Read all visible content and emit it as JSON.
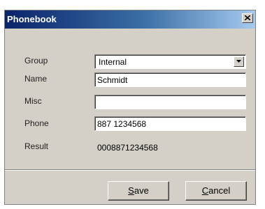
{
  "window": {
    "title": "Phonebook"
  },
  "fields": {
    "group": {
      "label": "Group",
      "value": "Internal"
    },
    "name": {
      "label": "Name",
      "value": "Schmidt"
    },
    "misc": {
      "label": "Misc",
      "value": ""
    },
    "phone": {
      "label": "Phone",
      "value": "887 1234568"
    },
    "result": {
      "label": "Result",
      "value": "0008871234568"
    }
  },
  "buttons": {
    "save": {
      "mnemonic": "S",
      "rest": "ave"
    },
    "cancel": {
      "mnemonic": "C",
      "rest": "ancel"
    }
  },
  "colors": {
    "titlebar_start": "#0a246a",
    "titlebar_end": "#a6caf0",
    "face": "#d4d0c8"
  },
  "icons": {
    "close": "close-icon",
    "dropdown": "chevron-down-icon"
  }
}
